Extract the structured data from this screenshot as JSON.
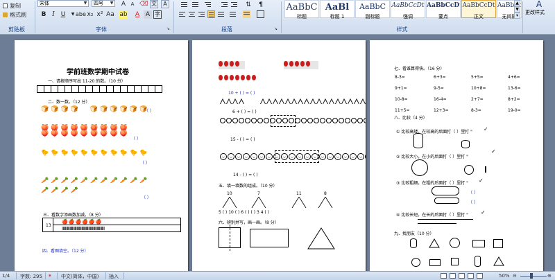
{
  "ribbon": {
    "clipboard": {
      "copy": "复制",
      "format_painter": "格式刷",
      "group_label": "剪贴板"
    },
    "font": {
      "family": "宋体",
      "size": "四号",
      "group_label": "字体"
    },
    "paragraph": {
      "group_label": "段落"
    },
    "styles": {
      "group_label": "样式",
      "items": [
        {
          "sample": "AaBbC",
          "name": "标题"
        },
        {
          "sample": "AaBl",
          "name": "标题 1"
        },
        {
          "sample": "AaBbC",
          "name": "副标题"
        },
        {
          "sample": "AaBbCcDt",
          "name": "强调"
        },
        {
          "sample": "AaBbCcDt",
          "name": "要点"
        },
        {
          "sample": "AaBbCcDt",
          "name": "正文"
        },
        {
          "sample": "AaBbCcDt",
          "name": "无间隔"
        }
      ],
      "change_styles": "更改样式"
    }
  },
  "page1": {
    "title": "学前班数学期中试卷",
    "q1": "一、请按顺序写出 11-20 的数。（10 分）",
    "q2": "二、数一数。（12 分）",
    "bracket": "（    ）",
    "q3": "三、看数字添画数加减。（8 分）",
    "q3_num": "13",
    "q4": "四、看图填空。（12 分）"
  },
  "page2": {
    "row1": "10  +  (      ) = (      )",
    "row2": "6  +  (      ) = (      )",
    "row3": "15  -  (      ) = (      )",
    "row4": "14  -  (      ) = (      )",
    "q5": "五、填一填数的组成。（10 分）",
    "trees": [
      "10",
      "7",
      "11",
      "8"
    ],
    "tree_leaves": "5   (    )   10   (    )  6  (    )  (    )  3     4   (    )",
    "q6": "六、辨别并写，画一画。（8 分）"
  },
  "page3": {
    "q7": "七、看谁算得快。（16 分）",
    "calc": [
      [
        "8-3=",
        "6+3=",
        "5+5=",
        "4+6="
      ],
      [
        "9+1=",
        "9-5=",
        "10+8=",
        "13-6="
      ],
      [
        "10-8=",
        "16-4=",
        "2+7=",
        "8+2="
      ],
      [
        "11+5=",
        "12+3=",
        "8-3=",
        "19-0="
      ]
    ],
    "q8": "八、比较（4 分）",
    "cmp1": "① 比较高矮，在较高的后面打（   ）里打 \"",
    "cmp2": "② 比较大小，在小的后面打（   ）里打 \"",
    "cmp3": "③ 比较粗细，在粗的后面打（   ）里打 \"",
    "cmp4": "④ 比较长短，在长的后面打（   ）里打 \"",
    "q9": "九、找朋友（10 分）"
  },
  "status": {
    "page": "1/4",
    "words": "字数: 295",
    "lang": "中文(简体，中国)",
    "mode": "插入",
    "zoom": "50%"
  }
}
